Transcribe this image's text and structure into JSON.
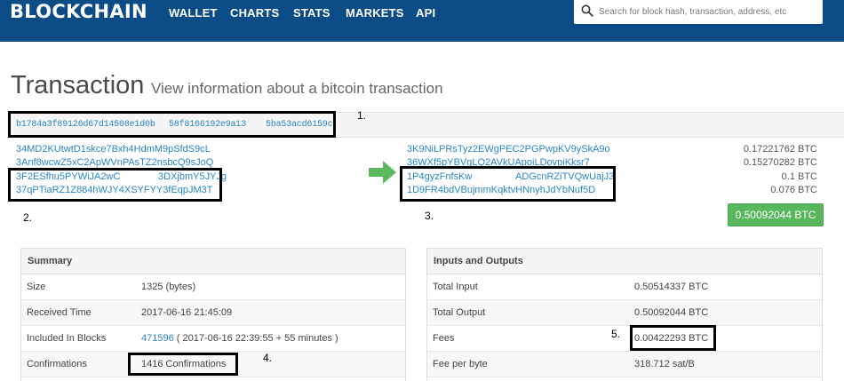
{
  "navbar": {
    "brand": "BLOCKCHAIN",
    "links": [
      "WALLET",
      "CHARTS",
      "STATS",
      "MARKETS",
      "API"
    ],
    "search_placeholder": "Search for block hash, transaction, address, etc"
  },
  "page": {
    "title": "Transaction",
    "subtitle": "View information about a bitcoin transaction"
  },
  "tx": {
    "hash_part1": "b1784a3f89126d67d14508e1d0b",
    "hash_part2": "58f8166192e9a13",
    "hash_part3": "5ba53acd6159c"
  },
  "inputs": [
    "34MD2KUtwtD1skce7Bxh4HdmM9pSfdS9cL",
    "3Anf8wcwZ5xC2ApWVnPAsTZ2nsbcQ9sJoQ",
    "3F2ESfhu5PYWiJA2wC",
    "3DXjbmY5JYJg",
    "37qPTiaRZ1Z884hWJY4XSYFYY3fEqpJM3T"
  ],
  "outputs": [
    {
      "address": "3K9NiLPRsTyz2EWgPEC2PGPwpKV9ySkA9o",
      "amount": "0.17221762 BTC"
    },
    {
      "address": "36WXf5pYBVgLQ2AVkUApoiLDovpiKksr7",
      "amount": "0.15270282 BTC"
    },
    {
      "address": "1P4gyzFnfsKw",
      "address_tail": "ADGcnRZiTVQwUajJ3",
      "amount": "0.1 BTC"
    },
    {
      "address": "1D9FR4bdVBujmmKqktvHNnyhJdYbNuf5D",
      "amount": "0.076 BTC"
    }
  ],
  "total_output": "0.50092044 BTC",
  "summary": {
    "heading": "Summary",
    "rows": [
      {
        "label": "Size",
        "value": "1325 (bytes)"
      },
      {
        "label": "Received Time",
        "value": "2017-06-16 21:45:09"
      },
      {
        "label": "Included In Blocks",
        "value_link": "471596",
        "value_rest": " ( 2017-06-16 22:39:55 + 55 minutes )"
      },
      {
        "label": "Confirmations",
        "value": "1416 Confirmations"
      }
    ]
  },
  "io": {
    "heading": "Inputs and Outputs",
    "rows": [
      {
        "label": "Total Input",
        "value": "0.50514337 BTC"
      },
      {
        "label": "Total Output",
        "value": "0.50092044 BTC"
      },
      {
        "label": "Fees",
        "value": "0.00422293 BTC"
      },
      {
        "label": "Fee per byte",
        "value": "318.712 sat/B"
      }
    ]
  },
  "annotations": [
    "1.",
    "2.",
    "3.",
    "4.",
    "5."
  ],
  "colors": {
    "navbar": "#0b4c86",
    "link": "#2a85c4",
    "success": "#58b65c",
    "arrow": "#5cb85c",
    "annotation_box": "#000000"
  },
  "icons": [
    "search-icon",
    "arrow-right-icon"
  ]
}
